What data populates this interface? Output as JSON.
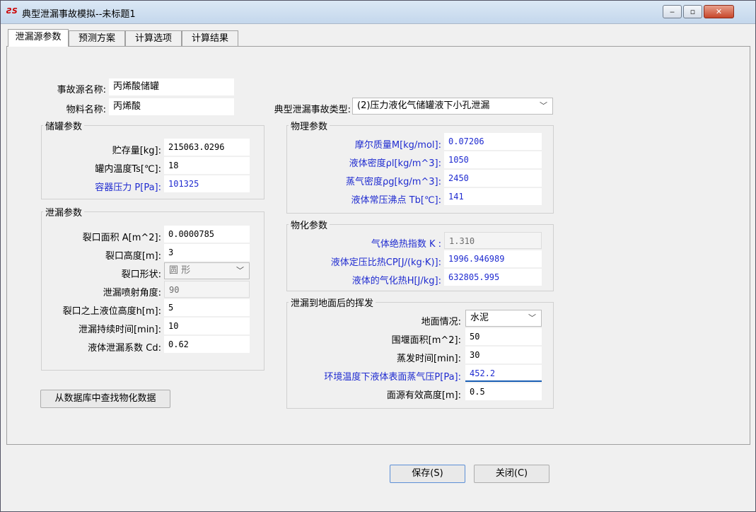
{
  "window": {
    "icon": "app-logo-icon",
    "title": "典型泄漏事故模拟--未标题1",
    "controls": {
      "minimize": "‒",
      "maximize": "▫",
      "close": "✕"
    }
  },
  "tabs": [
    {
      "label": "泄漏源参数",
      "active": true
    },
    {
      "label": "预测方案"
    },
    {
      "label": "计算选项"
    },
    {
      "label": "计算结果"
    }
  ],
  "source": {
    "name_label": "事故源名称:",
    "name_value": "丙烯酸储罐",
    "material_label": "物料名称:",
    "material_value": "丙烯酸",
    "type_label": "典型泄漏事故类型:",
    "type_value": "(2)压力液化气储罐液下小孔泄漏"
  },
  "tank": {
    "legend": "储罐参数",
    "storage_label": "贮存量[kg]:",
    "storage_value": "215063.0296",
    "temp_label": "罐内温度Ts[℃]:",
    "temp_value": "18",
    "pressure_label": "容器压力 P[Pa]:",
    "pressure_value": "101325"
  },
  "leak": {
    "legend": "泄漏参数",
    "area_label": "裂口面积 A[m^2]:",
    "area_value": "0.0000785",
    "height_label": "裂口高度[m]:",
    "height_value": "3",
    "shape_label": "裂口形状:",
    "shape_value": "圆 形",
    "angle_label": "泄漏喷射角度:",
    "angle_value": "90",
    "level_label": "裂口之上液位高度h[m]:",
    "level_value": "5",
    "duration_label": "泄漏持续时间[min]:",
    "duration_value": "10",
    "coef_label": "液体泄漏系数  Cd:",
    "coef_value": "0.62"
  },
  "physical": {
    "legend": "物理参数",
    "molar_label": "摩尔质量M[kg/mol]:",
    "molar_value": "0.07206",
    "liq_density_label": "液体密度ρl[kg/m^3]:",
    "liq_density_value": "1050",
    "vap_density_label": "蒸气密度ρg[kg/m^3]:",
    "vap_density_value": "2450",
    "boiling_label": "液体常压沸点 Tb[℃]:",
    "boiling_value": "141"
  },
  "chemical": {
    "legend": "物化参数",
    "kappa_label": "气体绝热指数  K :",
    "kappa_value": "1.310",
    "cp_label": "液体定压比热CP[J/(kg·K)]:",
    "cp_value": "1996.946989",
    "heat_label": "液体的气化热H[J/kg]:",
    "heat_value": "632805.995"
  },
  "evap": {
    "legend": "泄漏到地面后的挥发",
    "ground_label": "地面情况:",
    "ground_value": "水泥",
    "dike_label": "围堰面积[m^2]:",
    "dike_value": "50",
    "time_label": "蒸发时间[min]:",
    "time_value": "30",
    "vp_label": "环境温度下液体表面蒸气压P[Pa]:",
    "vp_value": "452.2",
    "height_label": "面源有效高度[m]:",
    "height_value": "0.5"
  },
  "buttons": {
    "lookup": "从数据库中查找物化数据",
    "save": "保存(S)",
    "close": "关闭(C)"
  }
}
